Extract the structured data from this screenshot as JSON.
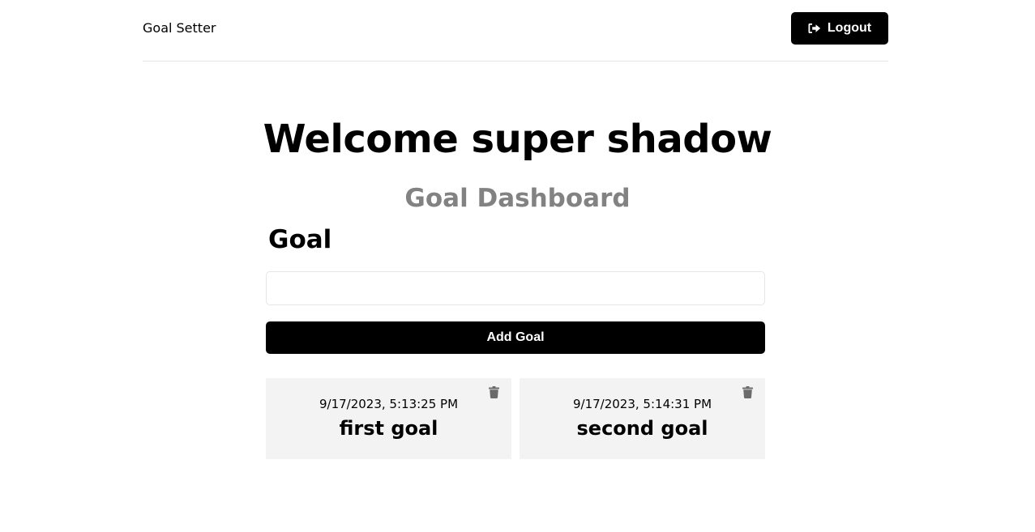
{
  "header": {
    "brand": "Goal Setter",
    "logout_label": "Logout",
    "logout_icon": "sign-out-icon"
  },
  "main": {
    "welcome": "Welcome super shadow",
    "dashboard_title": "Goal Dashboard",
    "form": {
      "goal_label": "Goal",
      "goal_input_value": "",
      "add_button_label": "Add Goal"
    },
    "goals": [
      {
        "date": "9/17/2023, 5:13:25 PM",
        "text": "first goal",
        "delete_icon": "trash-icon"
      },
      {
        "date": "9/17/2023, 5:14:31 PM",
        "text": "second goal",
        "delete_icon": "trash-icon"
      }
    ]
  }
}
